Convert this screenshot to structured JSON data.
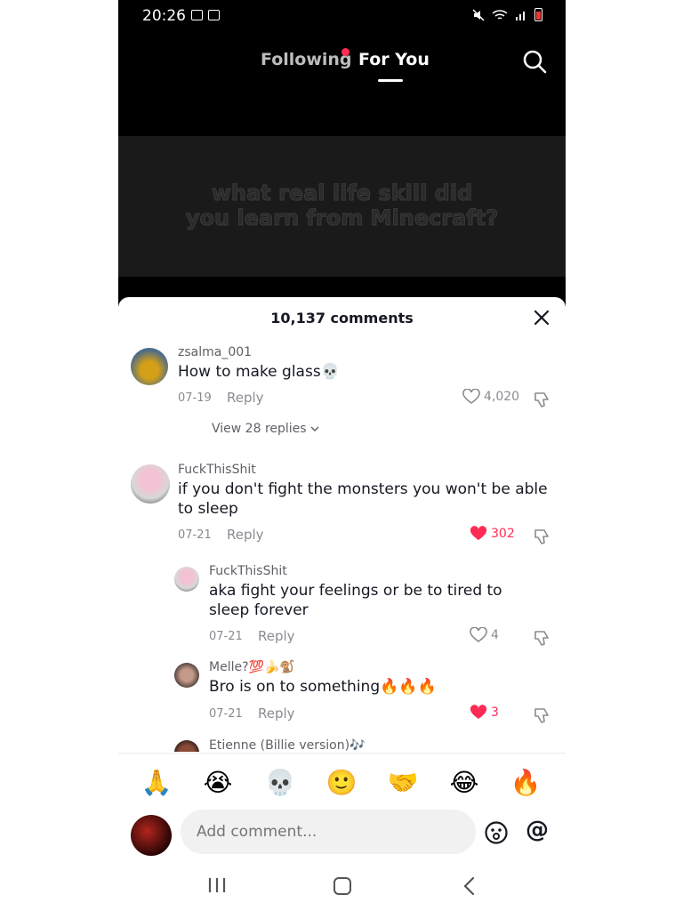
{
  "status_bar": {
    "time": "20:26"
  },
  "feed_tabs": {
    "following": "Following",
    "for_you": "For You"
  },
  "video": {
    "caption_line1": "what real life skill did",
    "caption_line2": "you learn from Minecraft?"
  },
  "comments_sheet": {
    "title": "10,137 comments"
  },
  "comments": [
    {
      "username": "zsalma_001",
      "text": "How to make glass💀",
      "date": "07-19",
      "reply": "Reply",
      "likes": "4,020",
      "liked": false,
      "view_replies": "View 28 replies"
    },
    {
      "username": "FuckThisShit",
      "text": "if you don't fight the monsters you won't be able to sleep",
      "date": "07-21",
      "reply": "Reply",
      "likes": "302",
      "liked": true
    },
    {
      "username": "FuckThisShit",
      "text": "aka fight your feelings or be to tired to sleep forever",
      "date": "07-21",
      "reply": "Reply",
      "likes": "4",
      "liked": false
    },
    {
      "username": "Melle?💯🍌🐒",
      "text": "Bro is on to something🔥🔥🔥",
      "date": "07-21",
      "reply": "Reply",
      "likes": "3",
      "liked": true
    },
    {
      "username": "Etienne (Billie version)🎶"
    }
  ],
  "emoji_bar": [
    "🙏",
    "😭",
    "💀",
    "🙂",
    "🤝",
    "😂",
    "🔥"
  ],
  "input": {
    "placeholder": "Add comment..."
  },
  "mention": "@",
  "colors": {
    "accent": "#fe2c55",
    "text": "#161823",
    "muted": "#8a8b91"
  }
}
